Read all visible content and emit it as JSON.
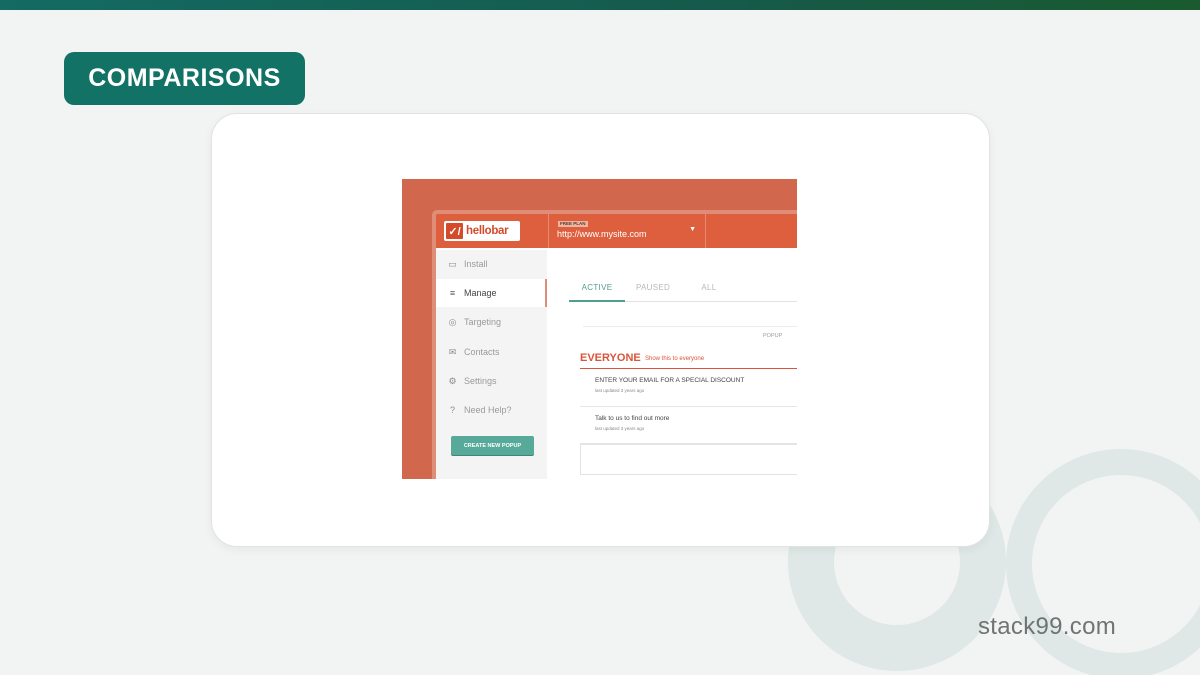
{
  "badge": {
    "label": "COMPARISONS"
  },
  "brand": {
    "text": "stack99.com"
  },
  "app": {
    "logo_text": "hellobar",
    "logo_mark": "✓/",
    "plan_tag": "FREE PLAN",
    "site_url": "http://www.mysite.com",
    "site_caret": "▼",
    "sidebar": {
      "items": [
        {
          "label": "Install",
          "icon": "install-icon",
          "glyph": "▭"
        },
        {
          "label": "Manage",
          "icon": "manage-icon",
          "glyph": "≡"
        },
        {
          "label": "Targeting",
          "icon": "target-icon",
          "glyph": "◎"
        },
        {
          "label": "Contacts",
          "icon": "envelope-icon",
          "glyph": "✉"
        },
        {
          "label": "Settings",
          "icon": "gear-icon",
          "glyph": "⚙"
        },
        {
          "label": "Need Help?",
          "icon": "help-icon",
          "glyph": "?"
        }
      ],
      "active_index": 1,
      "create_button": "CREATE NEW POPUP"
    },
    "tabs": [
      {
        "label": "ACTIVE"
      },
      {
        "label": "PAUSED"
      },
      {
        "label": "ALL"
      }
    ],
    "column_header": "POPUP",
    "group": {
      "title": "EVERYONE",
      "subtitle": "Show this to everyone"
    },
    "rows": [
      {
        "title": "ENTER YOUR EMAIL FOR A SPECIAL DISCOUNT",
        "meta": "last updated 3 years ago"
      },
      {
        "title": "Talk to us to find out more",
        "meta": "last updated 3 years ago"
      }
    ]
  },
  "colors": {
    "accent": "#137266",
    "hellobar_orange": "#de5f3e",
    "teal_button": "#57aa99"
  }
}
